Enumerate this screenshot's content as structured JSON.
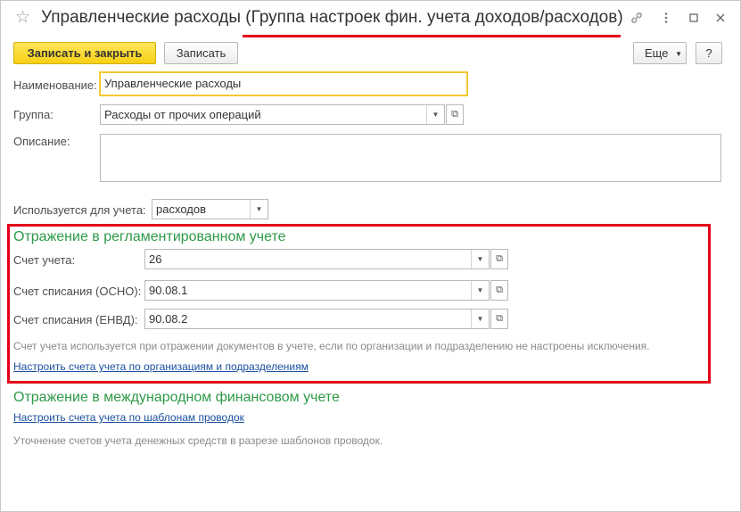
{
  "window": {
    "title": "Управленческие расходы (Группа настроек фин. учета доходов/расходов)"
  },
  "toolbar": {
    "save_close_label": "Записать и закрыть",
    "save_label": "Записать",
    "more_label": "Еще",
    "help_label": "?"
  },
  "form": {
    "name_label": "Наименование:",
    "name_value": "Управленческие расходы",
    "group_label": "Группа:",
    "group_value": "Расходы от прочих операций",
    "description_label": "Описание:",
    "description_value": "",
    "used_for_label": "Используется для учета:",
    "used_for_value": "расходов"
  },
  "regulated": {
    "title": "Отражение в регламентированном учете",
    "account_label": "Счет учета:",
    "account_value": "26",
    "writeoff_osno_label": "Счет списания (ОСНО):",
    "writeoff_osno_value": "90.08.1",
    "writeoff_envd_label": "Счет списания (ЕНВД):",
    "writeoff_envd_value": "90.08.2",
    "note": "Счет учета используется при отражении документов в учете, если по организации и подразделению не настроены исключения.",
    "link": "Настроить счета учета по организациям и подразделениям"
  },
  "international": {
    "title": "Отражение в международном финансовом учете",
    "link": "Настроить счета учета по шаблонам проводок",
    "note": "Уточнение счетов учета денежных средств в разрезе шаблонов проводок."
  },
  "icons": {
    "star": "star-icon",
    "link": "link-icon",
    "menu": "more-vertical-icon",
    "maximize": "maximize-icon",
    "close": "close-icon",
    "dropdown": "chevron-down-icon",
    "open": "open-form-icon"
  }
}
